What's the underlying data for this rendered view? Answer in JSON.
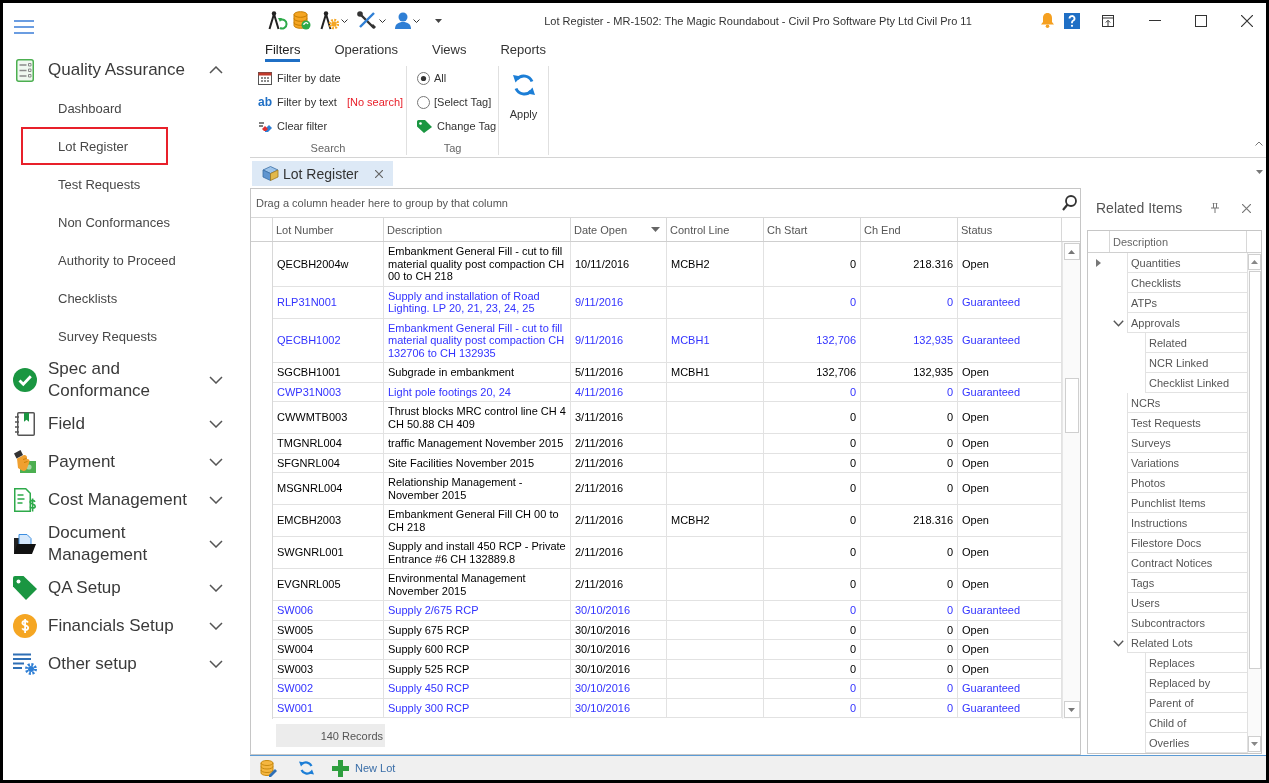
{
  "sidebar": {
    "sections": [
      {
        "label": "Quality Assurance",
        "expanded": true,
        "items": [
          {
            "label": "Dashboard",
            "selected": false
          },
          {
            "label": "Lot Register",
            "selected": true
          },
          {
            "label": "Test Requests",
            "selected": false
          },
          {
            "label": "Non Conformances",
            "selected": false
          },
          {
            "label": "Authority to Proceed",
            "selected": false
          },
          {
            "label": "Checklists",
            "selected": false
          },
          {
            "label": "Survey Requests",
            "selected": false
          }
        ]
      },
      {
        "label": "Spec and Conformance",
        "expanded": false
      },
      {
        "label": "Field",
        "expanded": false
      },
      {
        "label": "Payment",
        "expanded": false
      },
      {
        "label": "Cost Management",
        "expanded": false
      },
      {
        "label": "Document Management",
        "expanded": false
      },
      {
        "label": "QA Setup",
        "expanded": false
      },
      {
        "label": "Financials Setup",
        "expanded": false
      },
      {
        "label": "Other setup",
        "expanded": false
      }
    ]
  },
  "window": {
    "title": "Lot Register - MR-1502: The Magic Roundabout - Civil Pro Software Pty Ltd Civil Pro 11"
  },
  "ribbon": {
    "tabs": [
      {
        "label": "Filters",
        "selected": true
      },
      {
        "label": "Operations",
        "selected": false
      },
      {
        "label": "Views",
        "selected": false
      },
      {
        "label": "Reports",
        "selected": false
      }
    ],
    "search_group": {
      "label": "Search",
      "filter_by_date": "Filter by date",
      "text_icon": "ab",
      "filter_by_text": "Filter by text",
      "search_status": "[No search]",
      "clear_filter": "Clear filter"
    },
    "tag_group": {
      "label": "Tag",
      "options": [
        {
          "label": "All",
          "selected": true
        },
        {
          "label": "[Select Tag]",
          "selected": false
        }
      ],
      "change_tag": "Change Tag"
    },
    "apply": "Apply"
  },
  "document_tab": {
    "label": "Lot Register"
  },
  "grid": {
    "group_panel_hint": "Drag a column header here to group by that column",
    "columns": [
      {
        "label": "Lot Number",
        "kind": "text"
      },
      {
        "label": "Description",
        "kind": "long_text"
      },
      {
        "label": "Date Open",
        "kind": "text",
        "sort_descending": true
      },
      {
        "label": "Control Line",
        "kind": "text"
      },
      {
        "label": "Ch Start",
        "kind": "number"
      },
      {
        "label": "Ch End",
        "kind": "number"
      },
      {
        "label": "Status",
        "kind": "text"
      }
    ],
    "rows": [
      {
        "lot_number": "QECBH2004w",
        "description": "Embankment General Fill - cut to fill material quality post compaction CH 00 to CH 218",
        "date_open": "10/11/2016",
        "control_line": "MCBH2",
        "ch_start": "0",
        "ch_end": "218.316",
        "status": "Open",
        "color": "#000000"
      },
      {
        "lot_number": "RLP31N001",
        "description": "Supply and installation of Road Lighting. LP 20, 21, 23, 24, 25",
        "date_open": "9/11/2016",
        "ch_start": "0",
        "ch_end": "0",
        "status": "Guaranteed",
        "color": "#3333ff"
      },
      {
        "lot_number": "QECBH1002",
        "description": "Embankment General Fill - cut to fill material quality post compaction CH 132706 to CH 132935",
        "date_open": "9/11/2016",
        "control_line": "MCBH1",
        "ch_start": "132,706",
        "ch_end": "132,935",
        "status": "Guaranteed",
        "color": "#3333ff"
      },
      {
        "lot_number": "SGCBH1001",
        "description": "Subgrade in embankment",
        "date_open": "5/11/2016",
        "control_line": "MCBH1",
        "ch_start": "132,706",
        "ch_end": "132,935",
        "status": "Open",
        "color": "#000000"
      },
      {
        "lot_number": "CWP31N003",
        "description": "Light pole footings 20, 24",
        "date_open": "4/11/2016",
        "ch_start": "0",
        "ch_end": "0",
        "status": "Guaranteed",
        "color": "#3333ff"
      },
      {
        "lot_number": "CWWMTB003",
        "description": "Thrust blocks MRC control line CH 4 CH 50.88 CH 409",
        "date_open": "3/11/2016",
        "ch_start": "0",
        "ch_end": "0",
        "status": "Open",
        "color": "#000000"
      },
      {
        "lot_number": "TMGNRL004",
        "description": "traffic Management November 2015",
        "date_open": "2/11/2016",
        "ch_start": "0",
        "ch_end": "0",
        "status": "Open",
        "color": "#000000"
      },
      {
        "lot_number": "SFGNRL004",
        "description": "Site Facilities November 2015",
        "date_open": "2/11/2016",
        "ch_start": "0",
        "ch_end": "0",
        "status": "Open",
        "color": "#000000"
      },
      {
        "lot_number": "MSGNRL004",
        "description": "Relationship Management - November 2015",
        "date_open": "2/11/2016",
        "ch_start": "0",
        "ch_end": "0",
        "status": "Open",
        "color": "#000000"
      },
      {
        "lot_number": "EMCBH2003",
        "description": "Embankment General Fill CH 00 to CH 218",
        "date_open": "2/11/2016",
        "control_line": "MCBH2",
        "ch_start": "0",
        "ch_end": "218.316",
        "status": "Open",
        "color": "#000000"
      },
      {
        "lot_number": "SWGNRL001",
        "description": "Supply and install 450 RCP - Private Entrance #6 CH 132889.8",
        "date_open": "2/11/2016",
        "ch_start": "0",
        "ch_end": "0",
        "status": "Open",
        "color": "#000000"
      },
      {
        "lot_number": "EVGNRL005",
        "description": "Environmental Management November 2015",
        "date_open": "2/11/2016",
        "ch_start": "0",
        "ch_end": "0",
        "status": "Open",
        "color": "#000000"
      },
      {
        "lot_number": "SW006",
        "description": "Supply 2/675 RCP",
        "date_open": "30/10/2016",
        "ch_start": "0",
        "ch_end": "0",
        "status": "Guaranteed",
        "color": "#3333ff"
      },
      {
        "lot_number": "SW005",
        "description": "Supply 675 RCP",
        "date_open": "30/10/2016",
        "ch_start": "0",
        "ch_end": "0",
        "status": "Open",
        "color": "#000000"
      },
      {
        "lot_number": "SW004",
        "description": "Supply 600 RCP",
        "date_open": "30/10/2016",
        "ch_start": "0",
        "ch_end": "0",
        "status": "Open",
        "color": "#000000"
      },
      {
        "lot_number": "SW003",
        "description": "Supply 525 RCP",
        "date_open": "30/10/2016",
        "ch_start": "0",
        "ch_end": "0",
        "status": "Open",
        "color": "#000000"
      },
      {
        "lot_number": "SW002",
        "description": "Supply 450 RCP",
        "date_open": "30/10/2016",
        "ch_start": "0",
        "ch_end": "0",
        "status": "Guaranteed",
        "color": "#3333ff"
      },
      {
        "lot_number": "SW001",
        "description": "Supply 300 RCP",
        "date_open": "30/10/2016",
        "ch_start": "0",
        "ch_end": "0",
        "status": "Guaranteed",
        "color": "#3333ff"
      }
    ],
    "records": "140 Records"
  },
  "related_items": {
    "title": "Related Items",
    "column": "Description",
    "items": [
      {
        "label": "Quantities",
        "selected": true
      },
      {
        "label": "Checklists",
        "selected": false
      },
      {
        "label": "ATPs",
        "selected": false
      },
      {
        "label": "Approvals",
        "selected": false,
        "expanded": true,
        "children": [
          {
            "label": "Related",
            "selected": false
          },
          {
            "label": "NCR Linked",
            "selected": false
          },
          {
            "label": "Checklist Linked",
            "selected": false
          }
        ]
      },
      {
        "label": "NCRs",
        "selected": false
      },
      {
        "label": "Test Requests",
        "selected": false
      },
      {
        "label": "Surveys",
        "selected": false
      },
      {
        "label": "Variations",
        "selected": false
      },
      {
        "label": "Photos",
        "selected": false
      },
      {
        "label": "Punchlist Items",
        "selected": false
      },
      {
        "label": "Instructions",
        "selected": false
      },
      {
        "label": "Filestore Docs",
        "selected": false
      },
      {
        "label": "Contract Notices",
        "selected": false
      },
      {
        "label": "Tags",
        "selected": false
      },
      {
        "label": "Users",
        "selected": false
      },
      {
        "label": "Subcontractors",
        "selected": false
      },
      {
        "label": "Related Lots",
        "selected": false,
        "expanded": true,
        "children": [
          {
            "label": "Replaces",
            "selected": false
          },
          {
            "label": "Replaced by",
            "selected": false
          },
          {
            "label": "Parent of",
            "selected": false
          },
          {
            "label": "Child of",
            "selected": false
          },
          {
            "label": "Overlies",
            "selected": false
          }
        ]
      }
    ]
  },
  "bottom_toolbar": {
    "new_lot": "New Lot"
  }
}
